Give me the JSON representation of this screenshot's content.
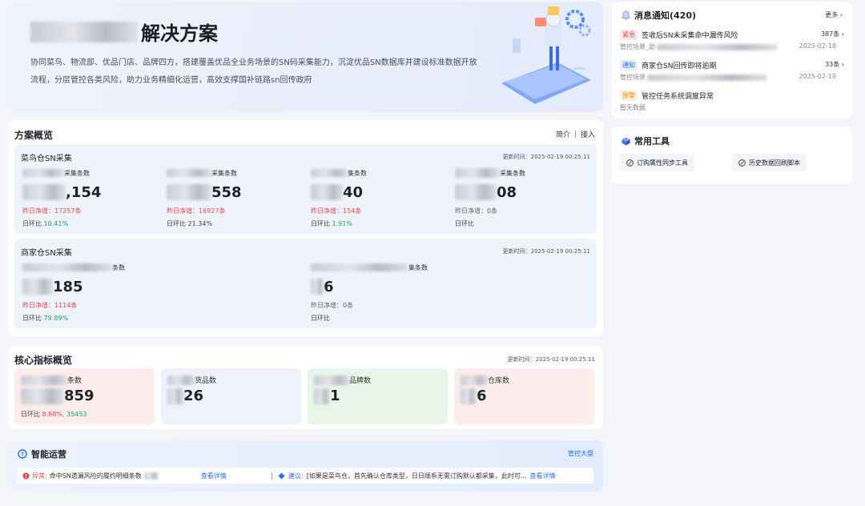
{
  "hero": {
    "title": "解决方案",
    "desc": "协同菜鸟、物流部、优品门店、品牌四方，搭建覆盖优品全业务场景的SN码采集能力，沉淀优品SN数据库并建设标准数据开放流程，分层管控各类风险，助力业务精细化运营，高效支撑国补链路sn回传政府"
  },
  "overview": {
    "title": "方案概览",
    "action_intro": "简介",
    "action_access": "接入",
    "cainiao": {
      "title": "菜鸟仓SN采集",
      "time": "更新时间：2025-02-19 00:25:11",
      "metrics": [
        {
          "label": "采集条数",
          "value": ",154",
          "inc_label": "昨日净增：",
          "inc": "17257条",
          "ratio_label": "日环比 ",
          "ratio": "10.41%"
        },
        {
          "label": "采集条数",
          "value": "558",
          "inc_label": "昨日净增：",
          "inc": "16927条",
          "ratio_label": "日环比 ",
          "ratio": "21.34%"
        },
        {
          "label": "集条数",
          "value": "40",
          "inc_label": "昨日净增：",
          "inc": "154条",
          "ratio_label": "日环比 ",
          "ratio": "1.91%"
        },
        {
          "label": "采集条数",
          "value": "08",
          "inc_label": "昨日净增：",
          "inc": "0条",
          "ratio_label": "日环比",
          "ratio": ""
        }
      ]
    },
    "merchant": {
      "title": "商家仓SN采集",
      "time": "更新时间：2025-02-19 00:25:11",
      "metrics": [
        {
          "label": "条数",
          "value": "185",
          "inc_label": "昨日净增：",
          "inc": "1114条",
          "ratio_label": "日环比 ",
          "ratio": "79.89%"
        },
        {
          "label": "集条数",
          "value": "6",
          "inc_label": "昨日净增：",
          "inc": "0条",
          "ratio_label": "日环比",
          "ratio": ""
        }
      ]
    }
  },
  "core": {
    "title": "核心指标概览",
    "time": "更新时间：2025-02-19 00:25:11",
    "items": [
      {
        "label": "条数",
        "value": "859",
        "ratio_label": "日环比 ",
        "ratio_red": "8.88%,",
        "ratio_green": " 35453",
        "bg": "#fdecec"
      },
      {
        "label": "货品数",
        "value": "26",
        "bg": "#edf2fb"
      },
      {
        "label": "品牌数",
        "value": "1",
        "bg": "#e8f6ea"
      },
      {
        "label": "仓库数",
        "value": "6",
        "bg": "#fdecec"
      }
    ]
  },
  "smart": {
    "title": "智能运营",
    "link": "管控大盘",
    "abnormal_tag": "异常:",
    "abnormal_text": "命中SN遗漏风险的履约明细条数",
    "abnormal_link": "查看详情",
    "suggest_tag": "建议:",
    "suggest_text": "[如果是菜鸟仓，首先确认仓库类型，日日顺系无需订购默认都采集，此时可...",
    "suggest_link": "查看详情"
  },
  "notice": {
    "title": "消息通知(420)",
    "more": "更多",
    "items": [
      {
        "badge": "紧急",
        "text": "签收后SN未采集命中漏传风险",
        "count": "387条",
        "sub": "管控场景_助",
        "date": "2025-02-18"
      },
      {
        "badge": "通知",
        "text": "商家仓SN回传即将逾期",
        "count": "33条",
        "sub": "管控场景",
        "date": "2025-02-19"
      },
      {
        "badge": "预警",
        "text": "管控任务系统调度异常",
        "count": "",
        "sub": "暂无数据",
        "date": ""
      }
    ]
  },
  "tools": {
    "title": "常用工具",
    "items": [
      "订购属性同步工具",
      "历史数据回刷脚本"
    ]
  },
  "colors": {
    "accent": "#2f6bff",
    "danger": "#e5484d",
    "success": "#1fa352",
    "warning": "#f08a24"
  }
}
